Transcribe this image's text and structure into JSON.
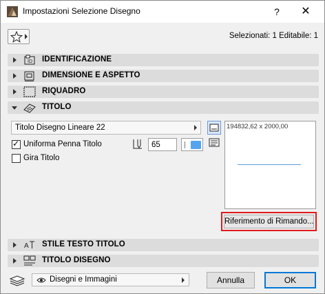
{
  "window": {
    "title": "Impostazioni Selezione Disegno",
    "help_glyph": "?",
    "close_glyph": "✕"
  },
  "toolbar": {
    "selection_info": "Selezionati: 1 Editabile: 1"
  },
  "panels": [
    {
      "label": "IDENTIFICAZIONE",
      "icon": "id-tag-icon",
      "expanded": false
    },
    {
      "label": "DIMENSIONE E ASPETTO",
      "icon": "size-appearance-icon",
      "expanded": false
    },
    {
      "label": "RIQUADRO",
      "icon": "frame-icon",
      "expanded": false
    },
    {
      "label": "TITOLO",
      "icon": "title-icon",
      "expanded": true
    },
    {
      "label": "STILE TESTO TITOLO",
      "icon": "text-style-icon",
      "expanded": false
    },
    {
      "label": "TITOLO DISEGNO",
      "icon": "drawing-title-icon",
      "expanded": false
    }
  ],
  "title_panel": {
    "title_type": "Titolo Disegno Lineare 22",
    "uniform_pen_label": "Uniforma Penna Titolo",
    "uniform_pen_checked": true,
    "pen_value": "65",
    "pen_color": "#55a4f0",
    "rotate_label": "Gira Titolo",
    "rotate_checked": false,
    "preview_size": "194832,62 x 2000,00",
    "reference_button": "Riferimento di Rimando..."
  },
  "footer": {
    "layer_value": "Disegni e Immagini",
    "cancel_label": "Annulla",
    "ok_label": "OK"
  }
}
